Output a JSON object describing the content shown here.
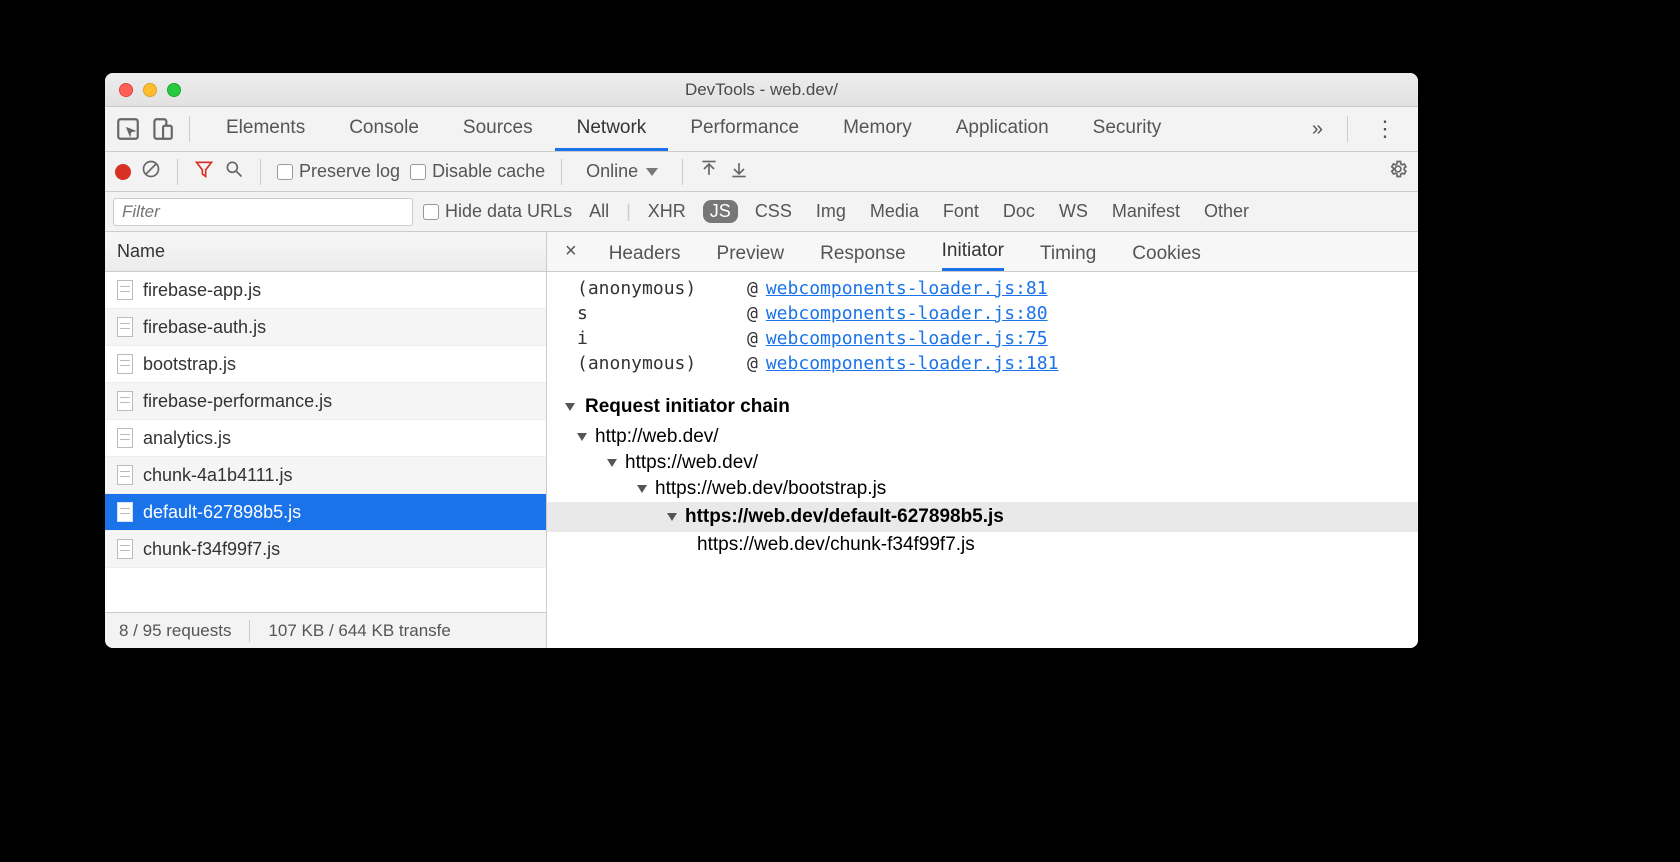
{
  "window": {
    "title": "DevTools - web.dev/"
  },
  "main_tabs": [
    "Elements",
    "Console",
    "Sources",
    "Network",
    "Performance",
    "Memory",
    "Application",
    "Security"
  ],
  "main_tab_active": "Network",
  "toolbar": {
    "preserve_log": "Preserve log",
    "disable_cache": "Disable cache",
    "throttling": "Online"
  },
  "filter": {
    "placeholder": "Filter",
    "hide_data": "Hide data URLs",
    "types": [
      "All",
      "XHR",
      "JS",
      "CSS",
      "Img",
      "Media",
      "Font",
      "Doc",
      "WS",
      "Manifest",
      "Other"
    ],
    "type_active": "JS"
  },
  "left": {
    "header": "Name",
    "requests": [
      "firebase-app.js",
      "firebase-auth.js",
      "bootstrap.js",
      "firebase-performance.js",
      "analytics.js",
      "chunk-4a1b4111.js",
      "default-627898b5.js",
      "chunk-f34f99f7.js"
    ],
    "selected": "default-627898b5.js",
    "status_requests": "8 / 95 requests",
    "status_transfer": "107 KB / 644 KB transfe"
  },
  "detail": {
    "tabs": [
      "Headers",
      "Preview",
      "Response",
      "Initiator",
      "Timing",
      "Cookies"
    ],
    "active": "Initiator",
    "stack": [
      {
        "fn": "(anonymous)",
        "link": "webcomponents-loader.js:81"
      },
      {
        "fn": "s",
        "link": "webcomponents-loader.js:80"
      },
      {
        "fn": "i",
        "link": "webcomponents-loader.js:75"
      },
      {
        "fn": "(anonymous)",
        "link": "webcomponents-loader.js:181"
      }
    ],
    "chain_title": "Request initiator chain",
    "chain": [
      {
        "indent": 0,
        "url": "http://web.dev/",
        "tri": true
      },
      {
        "indent": 1,
        "url": "https://web.dev/",
        "tri": true
      },
      {
        "indent": 2,
        "url": "https://web.dev/bootstrap.js",
        "tri": true
      },
      {
        "indent": 3,
        "url": "https://web.dev/default-627898b5.js",
        "tri": true,
        "hl": true
      },
      {
        "indent": 4,
        "url": "https://web.dev/chunk-f34f99f7.js",
        "tri": false
      }
    ]
  }
}
